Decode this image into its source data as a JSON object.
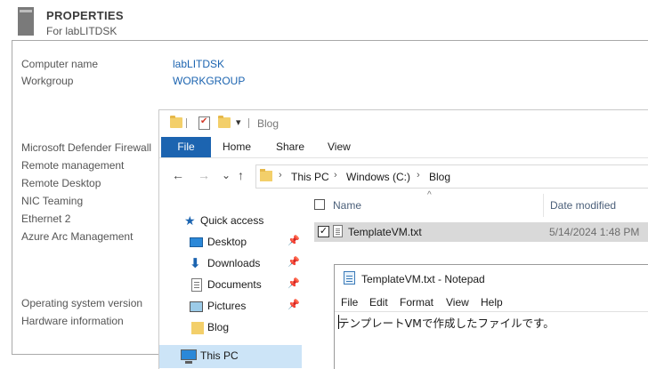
{
  "properties": {
    "title": "PROPERTIES",
    "subtitle": "For labLITDSK",
    "computer_name_label": "Computer name",
    "computer_name_value": "labLITDSK",
    "workgroup_label": "Workgroup",
    "workgroup_value": "WORKGROUP",
    "settings": [
      "Microsoft Defender Firewall",
      "Remote management",
      "Remote Desktop",
      "NIC Teaming",
      "Ethernet 2",
      "Azure Arc Management"
    ],
    "os_version_label": "Operating system version",
    "hardware_info_label": "Hardware information"
  },
  "explorer": {
    "title": "Blog",
    "quick_access_dropdown": "▾",
    "ribbon_tabs": [
      "File",
      "Home",
      "Share",
      "View"
    ],
    "nav_buttons": {
      "back": "←",
      "forward": "→",
      "recent": "⌄",
      "up": "↑"
    },
    "breadcrumb": [
      "This PC",
      "Windows (C:)",
      "Blog"
    ],
    "breadcrumb_sep": "›",
    "nav_pane": {
      "quick_access": "Quick access",
      "items": [
        "Desktop",
        "Downloads",
        "Documents",
        "Pictures",
        "Blog"
      ],
      "this_pc": "This PC"
    },
    "columns": {
      "name": "Name",
      "date_modified": "Date modified",
      "sort_indicator": "^"
    },
    "files": [
      {
        "name": "TemplateVM.txt",
        "date": "5/14/2024 1:48 PM",
        "checked": "✓"
      }
    ]
  },
  "notepad": {
    "title": "TemplateVM.txt - Notepad",
    "menu": [
      "File",
      "Edit",
      "Format",
      "View",
      "Help"
    ],
    "content": "テンプレートVMで作成したファイルです。"
  },
  "icons": {
    "pin": "📌",
    "star": "★"
  },
  "colors": {
    "accent": "#1c64b0",
    "selected_nav": "#cce4f7",
    "selected_row": "#d9d9d9"
  }
}
